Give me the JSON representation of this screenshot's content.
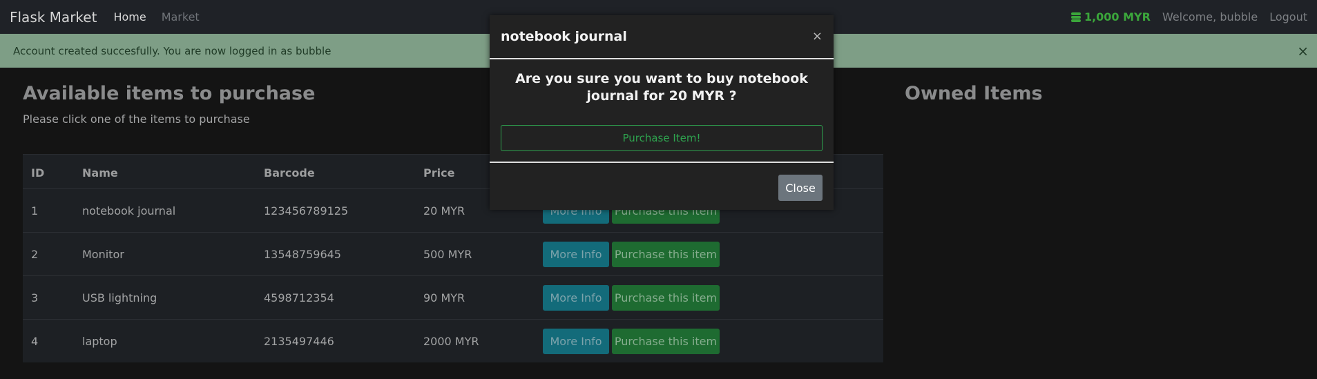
{
  "navbar": {
    "brand": "Flask Market",
    "links": {
      "home": "Home",
      "market": "Market"
    },
    "budget": "1,000 MYR",
    "welcome": "Welcome, bubble",
    "logout": "Logout",
    "colors": {
      "background": "#1f2227",
      "budget": "#3ba63b"
    }
  },
  "alert": {
    "message": "Account created succesfully. You are now logged in as bubble",
    "close": "×",
    "color": "#7e9e86"
  },
  "market": {
    "title": "Available items to purchase",
    "subtitle": "Please click one of the items to purchase",
    "columns": {
      "id": "ID",
      "name": "Name",
      "barcode": "Barcode",
      "price": "Price"
    },
    "rows": [
      {
        "id": "1",
        "name": "notebook journal",
        "barcode": "123456789125",
        "price": "20 MYR",
        "info": "More Info",
        "buy": "Purchase this item"
      },
      {
        "id": "2",
        "name": "Monitor",
        "barcode": "13548759645",
        "price": "500 MYR",
        "info": "More Info",
        "buy": "Purchase this item"
      },
      {
        "id": "3",
        "name": "USB lightning",
        "barcode": "4598712354",
        "price": "90 MYR",
        "info": "More Info",
        "buy": "Purchase this item"
      },
      {
        "id": "4",
        "name": "laptop",
        "barcode": "2135497446",
        "price": "2000 MYR",
        "info": "More Info",
        "buy": "Purchase this item"
      }
    ]
  },
  "owned": {
    "title": "Owned Items"
  },
  "modal": {
    "title": "notebook journal",
    "close_x": "×",
    "question": "Are you sure you want to buy notebook journal for 20 MYR ?",
    "purchase": "Purchase Item!",
    "close": "Close",
    "colors": {
      "purchase": "#2ea44f",
      "close": "#6c757d"
    }
  },
  "icons": {
    "budget": "coins-icon",
    "alert_close": "close-icon",
    "modal_close": "close-icon"
  }
}
